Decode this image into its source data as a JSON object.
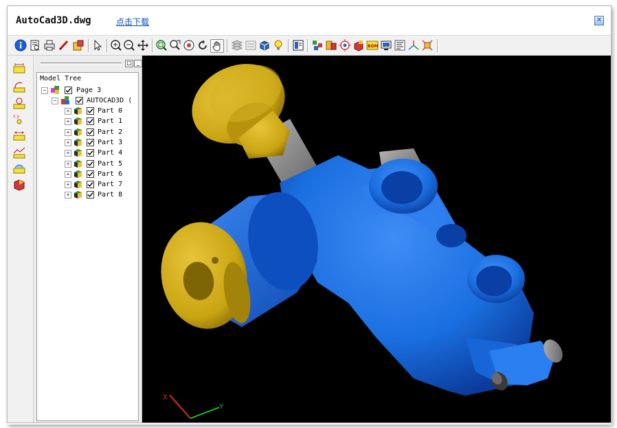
{
  "window": {
    "title": "AutoCad3D.dwg",
    "download_link": "点击下载"
  },
  "toolbar_icons": [
    "info-icon",
    "preview-icon",
    "print-icon",
    "markup-pen-icon",
    "export-icon",
    "select-arrow-icon",
    "zoom-in-icon",
    "zoom-out-icon",
    "pan-icon",
    "zoom-window-icon",
    "zoom-extents-icon",
    "zoom-fit-icon",
    "rotate-icon",
    "hand-pan-icon",
    "layers-icon",
    "dimension-icon",
    "cube-view-icon",
    "lightbulb-icon",
    "properties-icon",
    "explode-icon",
    "section-icon",
    "target-icon",
    "parts-icon",
    "bom-icon",
    "display-icon",
    "text-list-icon",
    "axis-icon",
    "fit-all-icon"
  ],
  "left_toolbar_icons": [
    "measure-distance-icon",
    "measure-angle-icon",
    "measure-radius-icon",
    "measure-point-icon",
    "measure-length-icon",
    "measure-chart-icon",
    "measure-area-icon",
    "box-icon"
  ],
  "model_tree": {
    "header": "Model Tree",
    "root": {
      "label": "Page 3",
      "expanded": true,
      "checked": true
    },
    "assembly": {
      "label": "AUTOCAD3D (",
      "expanded": true,
      "checked": true
    },
    "parts": [
      {
        "label": "Part 0",
        "checked": true
      },
      {
        "label": "Part 1",
        "checked": true
      },
      {
        "label": "Part 2",
        "checked": true
      },
      {
        "label": "Part 3",
        "checked": true
      },
      {
        "label": "Part 4",
        "checked": true
      },
      {
        "label": "Part 5",
        "checked": true
      },
      {
        "label": "Part 6",
        "checked": true
      },
      {
        "label": "Part 7",
        "checked": true
      },
      {
        "label": "Part 8",
        "checked": true
      }
    ]
  },
  "viewport": {
    "background": "#000000",
    "part_colors": {
      "body": "#1a6fe0",
      "caps": "#c9a412",
      "shaft": "#8a8a8a",
      "pin": "#3a3a3a"
    },
    "axis_labels": {
      "x": "X",
      "y": "Y"
    }
  },
  "colors": {
    "accent_link": "#0b4fc8",
    "window_bg": "#f3f3f3"
  }
}
